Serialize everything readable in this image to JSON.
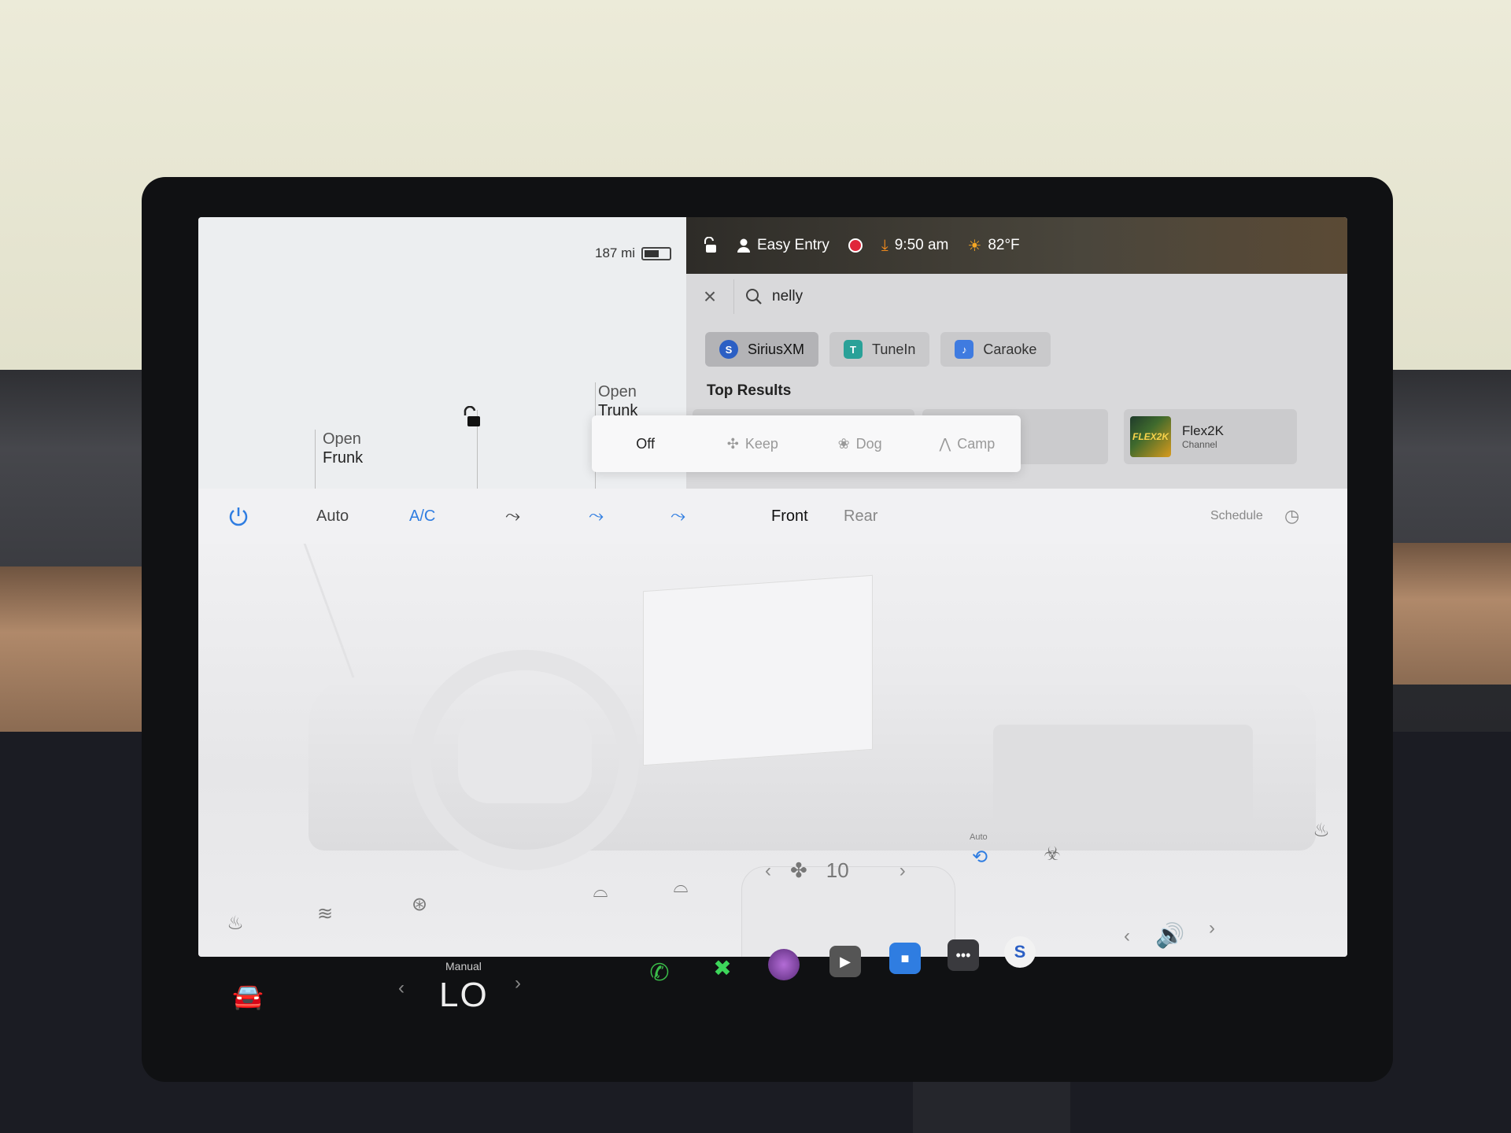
{
  "status_bar": {
    "range": "187 mi",
    "profile": "Easy Entry",
    "time": "9:50 am",
    "temperature": "82°F"
  },
  "car_panel": {
    "frunk": {
      "line1": "Open",
      "line2": "Frunk"
    },
    "trunk": {
      "line1": "Open",
      "line2": "Trunk"
    }
  },
  "media": {
    "search_value": "nelly",
    "sources": [
      {
        "label": "SiriusXM",
        "icon": "S",
        "color": "#2b5fc4"
      },
      {
        "label": "TuneIn",
        "icon": "T",
        "color": "#2aa198"
      },
      {
        "label": "Caraoke",
        "icon": "♪",
        "color": "#3f7be0"
      }
    ],
    "top_results_label": "Top Results",
    "result": {
      "title": "Flex2K",
      "subtitle": "Channel",
      "logo_text": "FLEX2K"
    }
  },
  "cabin_mode": {
    "options": [
      "Off",
      "Keep",
      "Dog",
      "Camp"
    ],
    "selected": "Off"
  },
  "climate": {
    "auto_label": "Auto",
    "ac_label": "A/C",
    "front_label": "Front",
    "rear_label": "Rear",
    "schedule_label": "Schedule",
    "fan_speed": "10",
    "recirc_label": "Auto"
  },
  "taskbar": {
    "temp_mode": "Manual",
    "temp_value": "LO"
  },
  "colors": {
    "accent_blue": "#2f7de1",
    "phone_green": "#3bbf4a"
  }
}
